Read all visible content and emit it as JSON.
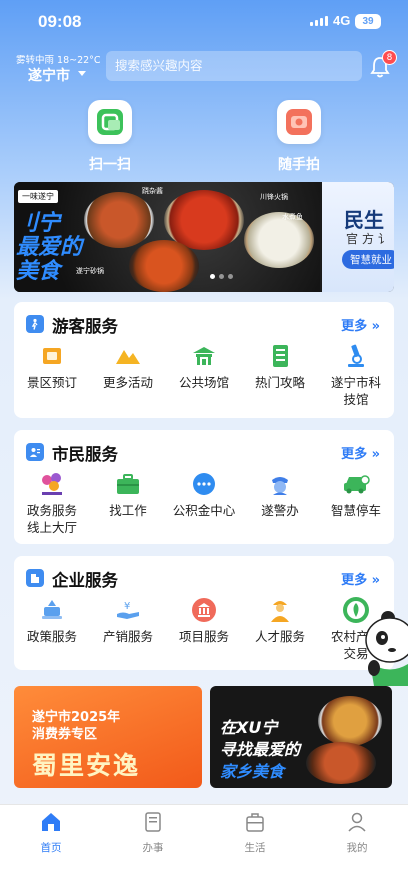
{
  "status_bar": {
    "time": "09:08",
    "network": "4G",
    "battery": "39"
  },
  "header": {
    "weather": "雾转中雨 18~22°C",
    "city": "遂宁市",
    "search_placeholder": "搜索感兴趣内容",
    "notification_count": "8"
  },
  "quick_actions": [
    {
      "label": "扫一扫",
      "icon": "scan-icon"
    },
    {
      "label": "随手拍",
      "icon": "camera-icon"
    }
  ],
  "banner": {
    "tag": "一味遂宁",
    "slogan_line1": "刂宁",
    "slogan_line2": "最爱的",
    "slogan_line3": "美食",
    "subtitle": "遂宁砂锅",
    "dish_labels": [
      "跷杂酱",
      "川锋火锅",
      "水煮鱼"
    ],
    "right_title": "民生",
    "right_subtitle": "官方讠",
    "right_pill": "智慧就业"
  },
  "sections": [
    {
      "title": "游客服务",
      "more": "更多 »",
      "items": [
        {
          "label": "景区预订",
          "icon": "ticket-icon",
          "color": "#f5a623"
        },
        {
          "label": "更多活动",
          "icon": "mountain-icon",
          "color": "#f5b423"
        },
        {
          "label": "公共场馆",
          "icon": "pavilion-icon",
          "color": "#3cb55a"
        },
        {
          "label": "热门攻略",
          "icon": "guidebook-icon",
          "color": "#3cb55a"
        },
        {
          "label": "遂宁市科技馆",
          "icon": "microscope-icon",
          "color": "#2f8cf0"
        }
      ]
    },
    {
      "title": "市民服务",
      "more": "更多 »",
      "items": [
        {
          "label": "政务服务线上大厅",
          "icon": "suixinban-logo-icon",
          "color": "#e0529c"
        },
        {
          "label": "找工作",
          "icon": "briefcase-icon",
          "color": "#3cb55a"
        },
        {
          "label": "公积金中心",
          "icon": "chat-dots-icon",
          "color": "#2f8cf0"
        },
        {
          "label": "遂警办",
          "icon": "police-icon",
          "color": "#3f7ee8"
        },
        {
          "label": "智慧停车",
          "icon": "car-icon",
          "color": "#3cb55a"
        }
      ]
    },
    {
      "title": "企业服务",
      "more": "更多 »",
      "items": [
        {
          "label": "政策服务",
          "icon": "policy-icon",
          "color": "#5aa0ee"
        },
        {
          "label": "产销服务",
          "icon": "hand-money-icon",
          "color": "#5aa0ee"
        },
        {
          "label": "项目服务",
          "icon": "bank-icon",
          "color": "#f06a5a"
        },
        {
          "label": "人才服务",
          "icon": "worker-icon",
          "color": "#f5a623"
        },
        {
          "label": "农村产权交易",
          "icon": "rural-property-icon",
          "color": "#3cb55a"
        }
      ]
    }
  ],
  "promos": {
    "left_line1": "遂宁市2025年",
    "left_line2": "消费券专区",
    "left_line3": "蜀里安逸",
    "right_line1": "在XU宁",
    "right_line2": "寻找最爱的",
    "right_line3": "家乡美食"
  },
  "tabs": [
    {
      "label": "首页",
      "active": true
    },
    {
      "label": "办事",
      "active": false
    },
    {
      "label": "生活",
      "active": false
    },
    {
      "label": "我的",
      "active": false
    }
  ]
}
